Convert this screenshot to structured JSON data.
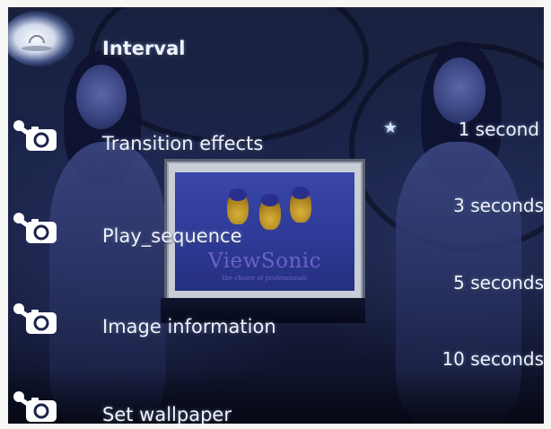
{
  "menu": {
    "items": [
      {
        "label": "Interval",
        "icon": "interval-icon",
        "selected": true
      },
      {
        "label": "Transition effects",
        "icon": "wrench-camera-icon",
        "selected": false
      },
      {
        "label": "Play_sequence",
        "icon": "wrench-camera-icon",
        "selected": false
      },
      {
        "label": "Image information",
        "icon": "wrench-camera-icon",
        "selected": false
      },
      {
        "label": "Set wallpaper",
        "icon": "wrench-camera-icon",
        "selected": false
      }
    ]
  },
  "options": {
    "items": [
      {
        "label": "1  second",
        "current": true
      },
      {
        "label": "3  seconds",
        "current": false
      },
      {
        "label": "5  seconds",
        "current": false
      },
      {
        "label": "10 seconds",
        "current": false
      }
    ],
    "current_marker": "star-icon"
  },
  "background": {
    "monitor_brand": "ViewSonic",
    "monitor_tagline": "the choice of professionals"
  },
  "colors": {
    "text": "#eef3ff",
    "selection_glow": "#ffffff",
    "background_dark": "#141a37"
  }
}
